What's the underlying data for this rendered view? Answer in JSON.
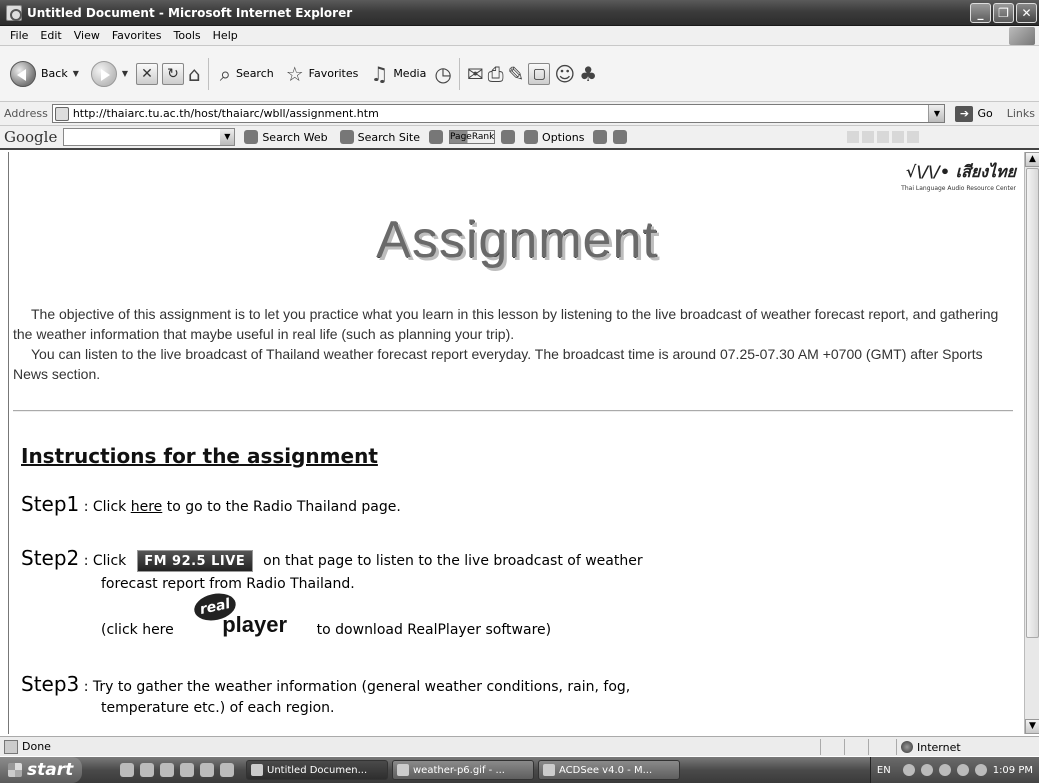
{
  "window": {
    "title": "Untitled Document - Microsoft Internet Explorer",
    "min_glyph": "_",
    "max_glyph": "❐",
    "close_glyph": "✕"
  },
  "menu": [
    "File",
    "Edit",
    "View",
    "Favorites",
    "Tools",
    "Help"
  ],
  "toolbar": {
    "back": "Back",
    "search": "Search",
    "favorites": "Favorites",
    "media": "Media"
  },
  "address": {
    "label": "Address",
    "url": "http://thaiarc.tu.ac.th/host/thaiarc/wbll/assignment.htm",
    "go": "Go",
    "links": "Links"
  },
  "google": {
    "logo": "Google",
    "search_web": "Search Web",
    "search_site": "Search Site",
    "pagerank": "PageRank",
    "options": "Options"
  },
  "page": {
    "logo_text": "√\\/\\/• เสียงไทย",
    "logo_sub": "Thai Language Audio Resource Center",
    "heading": "Assignment",
    "intro_1": "The objective of this assignment is to let you practice what you learn in this lesson by listening to the live broadcast of weather forecast report, and gathering the weather information that maybe useful in real life (such as planning your trip).",
    "intro_2": "You can listen to the live broadcast of Thailand weather forecast report everyday. The broadcast time is around 07.25-07.30 AM +0700 (GMT) after Sports News section.",
    "instructions_title": "Instructions for the assignment",
    "step1": {
      "label": "Step1",
      "pre": "Click",
      "link": "here",
      "post": "to go to the Radio Thailand page."
    },
    "step2": {
      "label": "Step2",
      "pre": "Click",
      "badge": "FM 92.5 LIVE",
      "post": "on that page to listen to the live broadcast of weather",
      "line2": "forecast report from Radio Thailand.",
      "rp_pre": "(click here",
      "rp_oval": "real",
      "rp_word": "player",
      "rp_post": "to download RealPlayer software)"
    },
    "step3": {
      "label": "Step3",
      "line1": "Try to gather the weather information (general weather conditions, rain, fog,",
      "line2": "temperature etc.) of each region."
    }
  },
  "status": {
    "text": "Done",
    "zone": "Internet"
  },
  "taskbar": {
    "start": "start",
    "tasks": [
      "Untitled Documen...",
      "weather-p6.gif - ...",
      "ACDSee v4.0 - M..."
    ],
    "lang": "EN",
    "clock": "1:09 PM"
  }
}
